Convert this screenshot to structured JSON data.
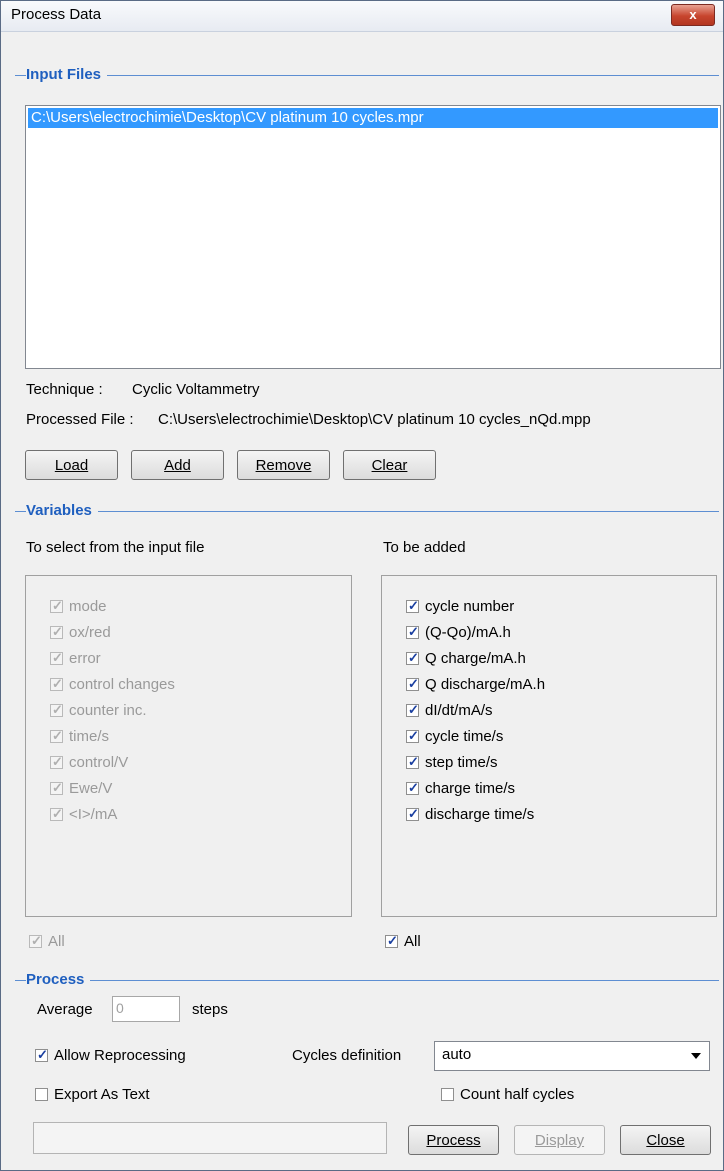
{
  "window": {
    "title": "Process Data",
    "close_glyph": "x"
  },
  "input_files": {
    "section_title": "Input Files",
    "files": [
      "C:\\Users\\electrochimie\\Desktop\\CV platinum 10 cycles.mpr"
    ],
    "technique_label": "Technique :",
    "technique_value": "Cyclic Voltammetry",
    "processed_label": "Processed File :",
    "processed_value": "C:\\Users\\electrochimie\\Desktop\\CV platinum 10 cycles_nQd.mpp",
    "buttons": {
      "load": "Load",
      "add": "Add",
      "remove": "Remove",
      "clear": "Clear"
    }
  },
  "variables": {
    "section_title": "Variables",
    "left_header": "To select from the input file",
    "right_header": "To be added",
    "left_items": [
      {
        "label": "mode",
        "checked": true
      },
      {
        "label": "ox/red",
        "checked": true
      },
      {
        "label": "error",
        "checked": true
      },
      {
        "label": "control changes",
        "checked": true
      },
      {
        "label": "counter inc.",
        "checked": true
      },
      {
        "label": "time/s",
        "checked": true
      },
      {
        "label": "control/V",
        "checked": true
      },
      {
        "label": "Ewe/V",
        "checked": true
      },
      {
        "label": "<I>/mA",
        "checked": true
      }
    ],
    "right_items": [
      {
        "label": "cycle number",
        "checked": true
      },
      {
        "label": "(Q-Qo)/mA.h",
        "checked": true
      },
      {
        "label": "Q charge/mA.h",
        "checked": true
      },
      {
        "label": "Q discharge/mA.h",
        "checked": true
      },
      {
        "label": "dI/dt/mA/s",
        "checked": true
      },
      {
        "label": "cycle time/s",
        "checked": true
      },
      {
        "label": "step time/s",
        "checked": true
      },
      {
        "label": "charge time/s",
        "checked": true
      },
      {
        "label": "discharge time/s",
        "checked": true
      }
    ],
    "left_all_label": "All",
    "right_all_label": "All"
  },
  "process": {
    "section_title": "Process",
    "average_label": "Average",
    "average_value": "0",
    "steps_label": "steps",
    "allow_reprocessing_label": "Allow Reprocessing",
    "allow_reprocessing_checked": true,
    "cycles_definition_label": "Cycles definition",
    "cycles_definition_value": "auto",
    "export_as_text_label": "Export As Text",
    "export_as_text_checked": false,
    "count_half_cycles_label": "Count half cycles",
    "count_half_cycles_checked": false,
    "buttons": {
      "process": "Process",
      "display": "Display",
      "close": "Close"
    }
  },
  "colors": {
    "section_title": "#1f5fbf",
    "selection": "#3399ff",
    "close_button": "#c7452e"
  }
}
